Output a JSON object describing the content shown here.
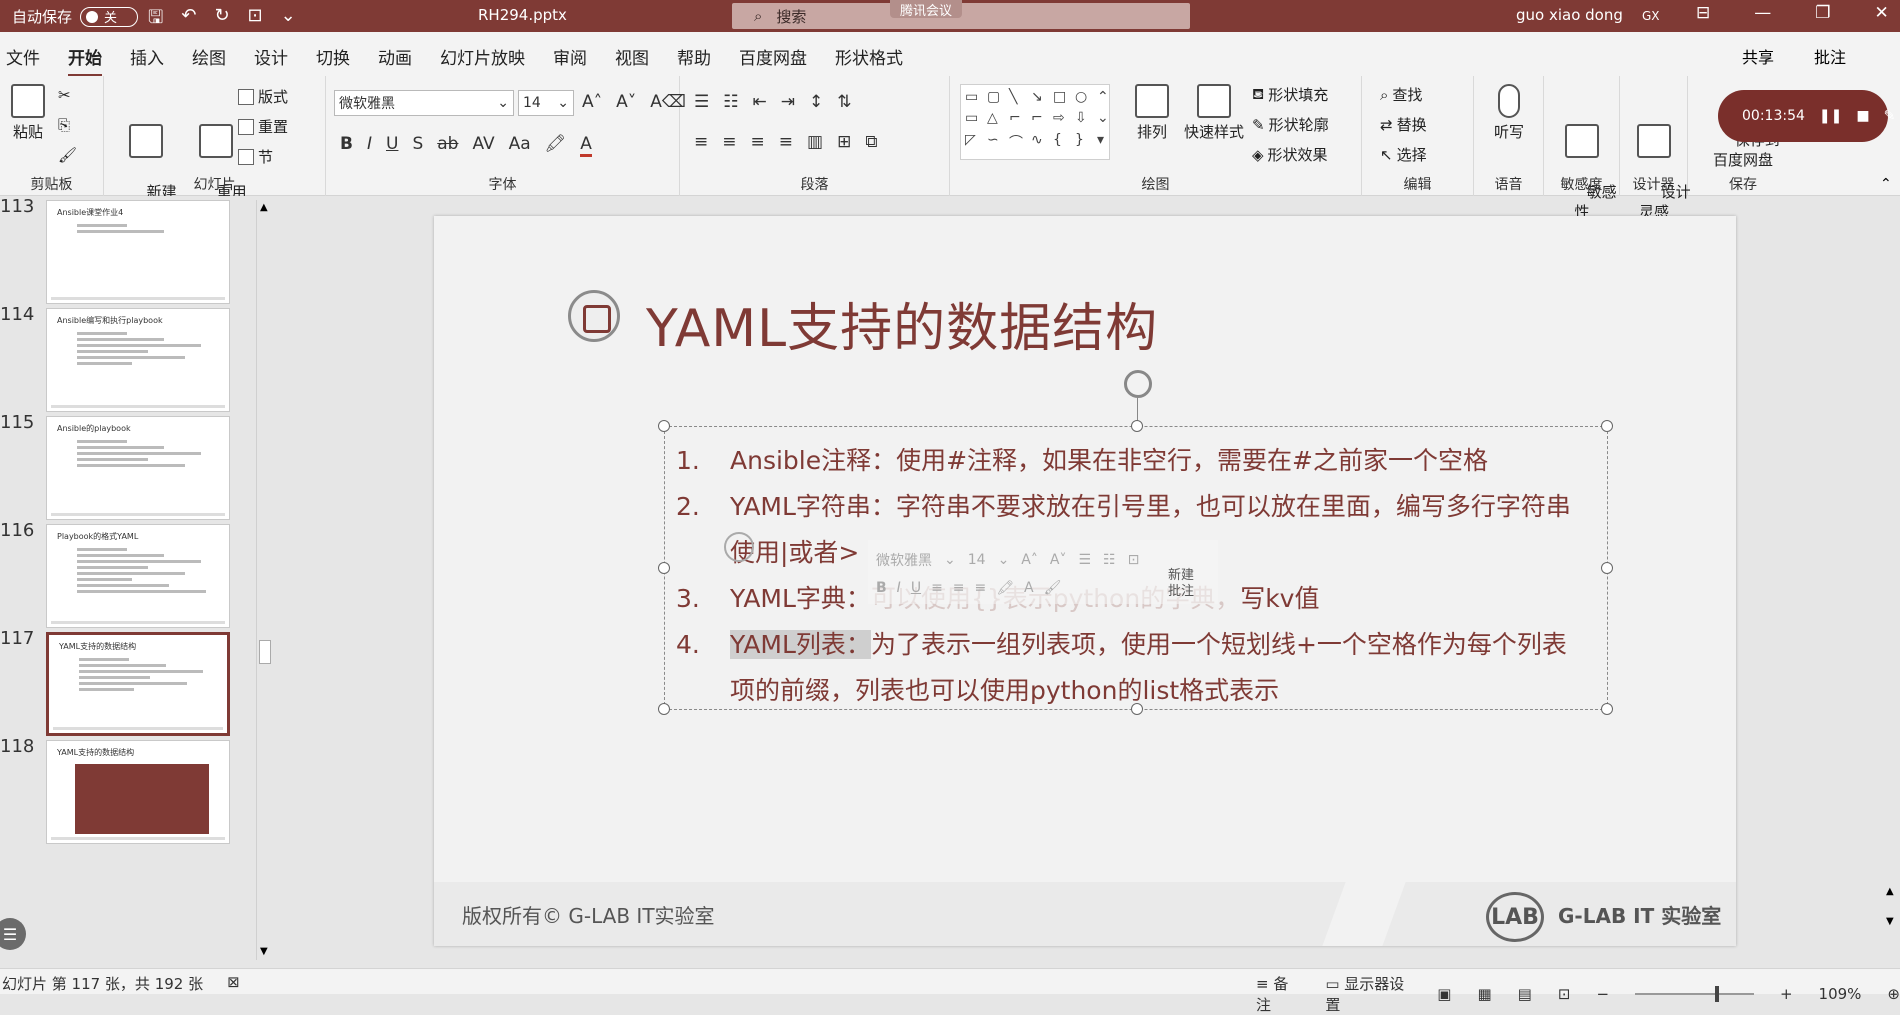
{
  "titlebar": {
    "autosave_label": "自动保存",
    "autosave_state": "关",
    "filename": "RH294.pptx",
    "search_placeholder": "搜索",
    "meeting_badge": "腾讯会议",
    "user_name": "guo xiao dong",
    "user_initials": "GX"
  },
  "menu": {
    "tabs": [
      "文件",
      "开始",
      "插入",
      "绘图",
      "设计",
      "切换",
      "动画",
      "幻灯片放映",
      "审阅",
      "视图",
      "帮助",
      "百度网盘",
      "形状格式"
    ],
    "active_index": 1,
    "share": "共享",
    "comment": "批注"
  },
  "ribbon": {
    "clipboard": {
      "paste": "粘贴",
      "label": "剪贴板"
    },
    "slides": {
      "new_slide": "新建\n幻灯片",
      "reuse_slide": "重用\n幻灯片",
      "layout": "版式",
      "reset": "重置",
      "section": "节",
      "label": "幻灯片"
    },
    "font": {
      "name": "微软雅黑",
      "size": "14",
      "label": "字体"
    },
    "paragraph": {
      "label": "段落"
    },
    "drawing": {
      "arrange": "排列",
      "quick_styles": "快速样式",
      "shape_fill": "形状填充",
      "shape_outline": "形状轮廓",
      "shape_effects": "形状效果",
      "label": "绘图"
    },
    "editing": {
      "find": "查找",
      "replace": "替换",
      "select": "选择",
      "label": "编辑"
    },
    "voice": {
      "dictate": "听写",
      "label": "语音"
    },
    "sensitivity": {
      "btn": "敏感\n性",
      "label": "敏感度"
    },
    "designer": {
      "btn": "设计\n灵感",
      "label": "设计器"
    },
    "save": {
      "btn": "保存到\n百度网盘",
      "label": "保存"
    }
  },
  "recording": {
    "time": "00:13:54"
  },
  "thumbnails": [
    {
      "num": "113",
      "title": "Ansible课堂作业4"
    },
    {
      "num": "114",
      "title": "Ansible编写和执行playbook"
    },
    {
      "num": "115",
      "title": "Ansible的playbook"
    },
    {
      "num": "116",
      "title": "Playbook的格式YAML"
    },
    {
      "num": "117",
      "title": "YAML支持的数据结构"
    },
    {
      "num": "118",
      "title": "YAML支持的数据结构"
    }
  ],
  "slide": {
    "title": "YAML支持的数据结构",
    "items": [
      {
        "num": "1.",
        "text": "Ansible注释：使用#注释，如果在非空行，需要在#之前家一个空格"
      },
      {
        "num": "2.",
        "text": "YAML字符串：字符串不要求放在引号里，也可以放在里面，编写多行字符串",
        "cont": "使用|或者>"
      },
      {
        "num": "3.",
        "label": "YAML字典：",
        "faded": "可以使用{}表示python的字典，",
        "tail": "写kv值"
      },
      {
        "num": "4.",
        "label": "YAML列表：",
        "text": "为了表示一组列表项，使用一个短划线+一个空格作为每个列表",
        "cont": "项的前缀，列表也可以使用python的list格式表示"
      }
    ],
    "mini_toolbar": {
      "font": "微软雅黑",
      "size": "14",
      "new_note": "新建\n批注"
    },
    "footer_copyright": "版权所有© G-LAB IT实验室",
    "footer_logo": "LAB",
    "footer_lab": "G-LAB IT 实验室"
  },
  "status": {
    "slide_info": "幻灯片 第 117 张，共 192 张",
    "notes": "备注",
    "display_settings": "显示器设置",
    "zoom": "109%"
  }
}
